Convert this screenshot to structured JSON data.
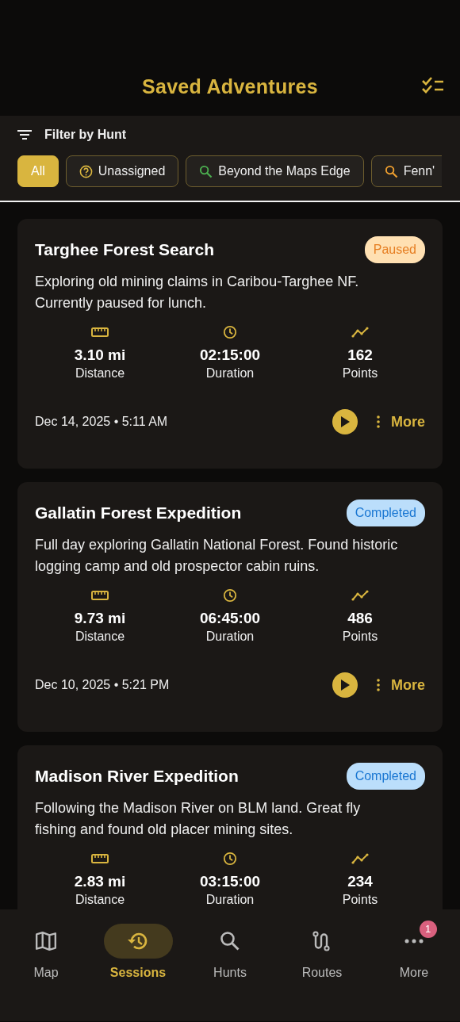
{
  "header": {
    "title": "Saved Adventures"
  },
  "filter": {
    "label": "Filter by Hunt",
    "chips": [
      {
        "label": "All",
        "selected": true,
        "kind": "plain"
      },
      {
        "label": "Unassigned",
        "selected": false,
        "kind": "question",
        "color": "#d9b53f"
      },
      {
        "label": "Beyond the Maps Edge",
        "selected": false,
        "kind": "search",
        "color": "#4caf50"
      },
      {
        "label": "Fenn'",
        "selected": false,
        "kind": "search",
        "color": "#f0a030"
      }
    ]
  },
  "sessions": [
    {
      "title": "Targhee Forest Search",
      "status": {
        "label": "Paused",
        "kind": "paused"
      },
      "description": "Exploring old mining claims in Caribou-Targhee NF. Currently paused for lunch.",
      "stats": [
        {
          "kind": "distance",
          "value": "3.10 mi",
          "label": "Distance"
        },
        {
          "kind": "duration",
          "value": "02:15:00",
          "label": "Duration"
        },
        {
          "kind": "points",
          "value": "162",
          "label": "Points"
        }
      ],
      "date": "Dec 14, 2025 • 5:11 AM",
      "more": "More"
    },
    {
      "title": "Gallatin Forest Expedition",
      "status": {
        "label": "Completed",
        "kind": "completed"
      },
      "description": "Full day exploring Gallatin National Forest. Found historic logging camp and old prospector cabin ruins.",
      "stats": [
        {
          "kind": "distance",
          "value": "9.73 mi",
          "label": "Distance"
        },
        {
          "kind": "duration",
          "value": "06:45:00",
          "label": "Duration"
        },
        {
          "kind": "points",
          "value": "486",
          "label": "Points"
        }
      ],
      "date": "Dec 10, 2025 • 5:21 PM",
      "more": "More"
    },
    {
      "title": "Madison River Expedition",
      "status": {
        "label": "Completed",
        "kind": "completed"
      },
      "description": "Following the Madison River on BLM land. Great fly fishing and found old placer mining sites.",
      "stats": [
        {
          "kind": "distance",
          "value": "2.83 mi",
          "label": "Distance"
        },
        {
          "kind": "duration",
          "value": "03:15:00",
          "label": "Duration"
        },
        {
          "kind": "points",
          "value": "234",
          "label": "Points"
        }
      ]
    }
  ],
  "nav": [
    {
      "label": "Map",
      "kind": "map",
      "selected": false
    },
    {
      "label": "Sessions",
      "kind": "history",
      "selected": true
    },
    {
      "label": "Hunts",
      "kind": "search",
      "selected": false
    },
    {
      "label": "Routes",
      "kind": "route",
      "selected": false
    },
    {
      "label": "More",
      "kind": "more",
      "selected": false,
      "badge": "1"
    }
  ]
}
